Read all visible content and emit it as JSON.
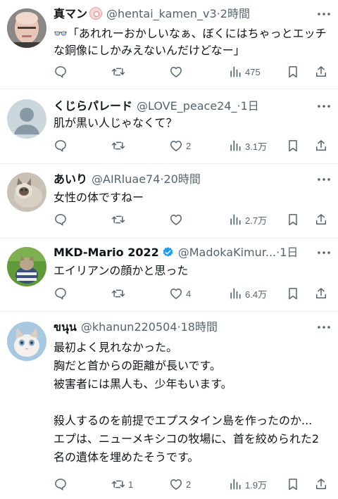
{
  "tweets": [
    {
      "name": "真マン",
      "emoji_icon": "smiley-badge-icon",
      "handle": "@hentai_kamen_v3",
      "dot": "·",
      "time": "2時間",
      "body": "👓「あれれーおかしいなぁ、ぼくにはちゃっとエッチな銅像にしかみえないんだけどなー」",
      "reply_count": "",
      "retweet_count": "",
      "like_count": "",
      "view_count": "475"
    },
    {
      "name": "くじらパレード",
      "handle": "@LOVE_peace24_",
      "dot": "·",
      "time": "1日",
      "body": "肌が黒い人じゃなくて？",
      "reply_count": "",
      "retweet_count": "",
      "like_count": "2",
      "view_count": "3.1万"
    },
    {
      "name": "あいり",
      "handle": "@AIRluae74",
      "dot": "·",
      "time": "20時間",
      "body": "女性の体ですねー",
      "reply_count": "",
      "retweet_count": "",
      "like_count": "",
      "view_count": "2.7万"
    },
    {
      "name": "MKD-Mario 2022",
      "verified_icon": "verified-badge-icon",
      "handle": "@MadokaKimur...",
      "dot": "·",
      "time": "1日",
      "body": "エイリアンの顔かと思った",
      "reply_count": "",
      "retweet_count": "",
      "like_count": "4",
      "view_count": "6.4万"
    },
    {
      "name": "ขนุน",
      "handle": "@khanun220504",
      "dot": "·",
      "time": "18時間",
      "body": "最初よく見れなかった。\n胸だと首からの距離が長いです。\n被害者には黒人も、少年もいます。\n\n殺人するのを前提でエプスタイン島を作ったのか...\nエプは、ニューメキシコの牧場に、首を絞められた2名の遺体を埋めたそうです。",
      "reply_count": "",
      "retweet_count": "1",
      "like_count": "2",
      "view_count": "1.9万"
    }
  ],
  "icons": {
    "reply": "reply-bubble-icon",
    "retweet": "retweet-icon",
    "like": "heart-icon",
    "views": "views-bar-chart-icon",
    "bookmark": "bookmark-icon",
    "share": "share-upload-icon",
    "more": "more-dots-icon"
  },
  "colors": {
    "text": "#0f1419",
    "secondary": "#536471",
    "divider": "#eff3f4",
    "verified": "#1d9bf0"
  }
}
